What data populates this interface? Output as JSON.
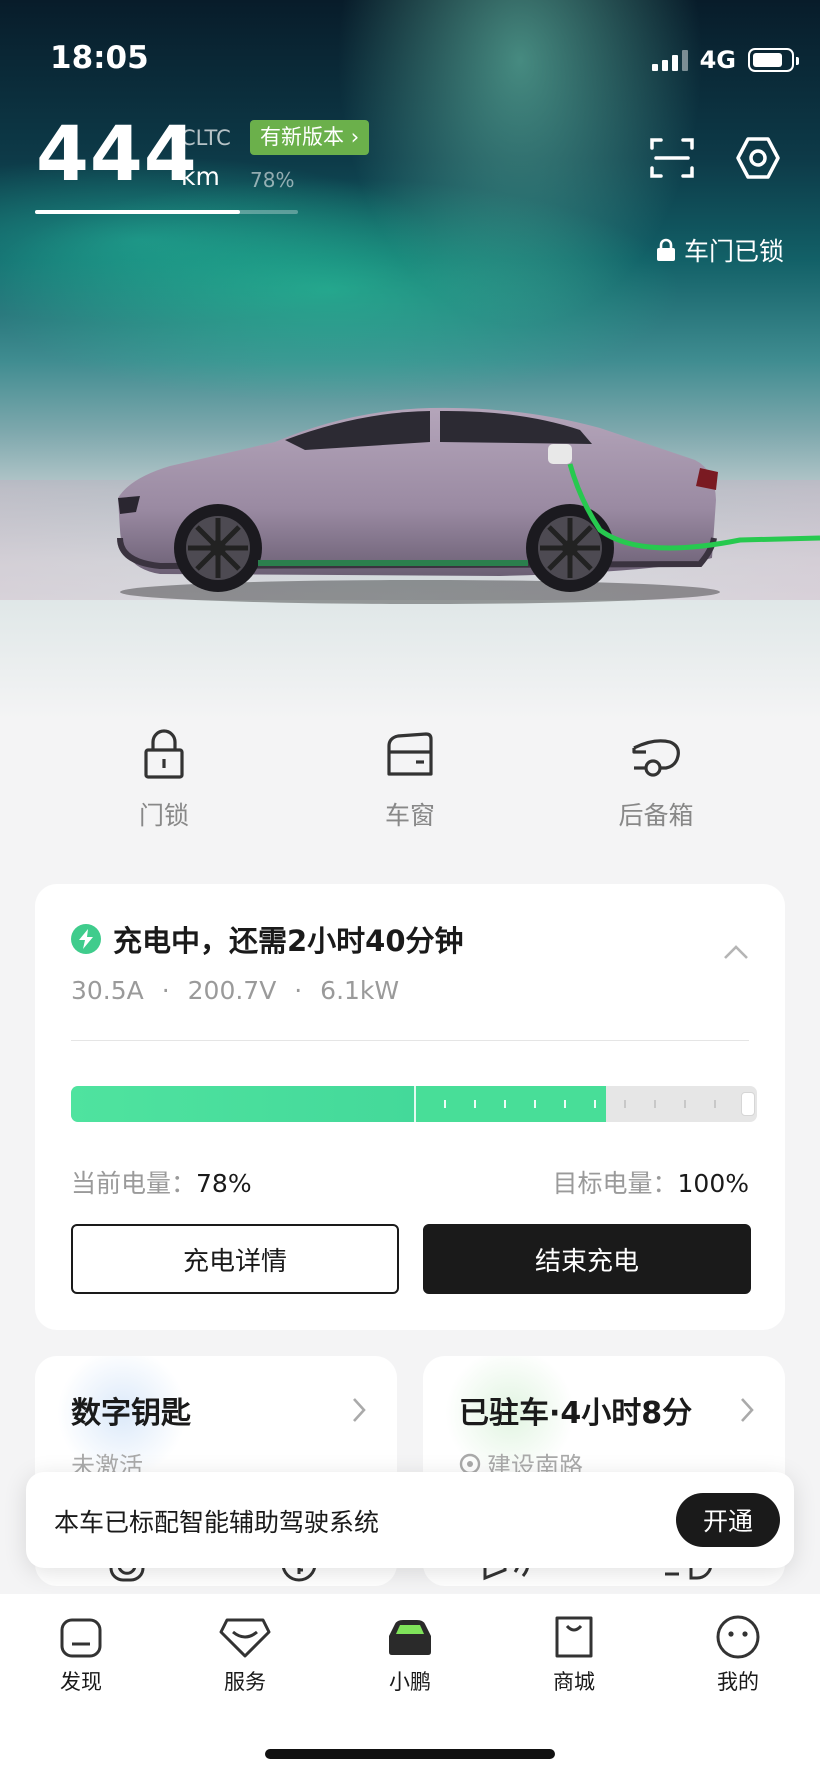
{
  "status_bar": {
    "time": "18:05",
    "network": "4G"
  },
  "vehicle": {
    "range_value": "444",
    "range_standard": "CLTC",
    "range_unit": "km",
    "battery_percent_label": "78%",
    "battery_fraction": 0.78,
    "update_badge": "有新版本",
    "door_status": "车门已锁"
  },
  "quick_actions": [
    {
      "label": "门锁",
      "icon": "padlock-icon"
    },
    {
      "label": "车窗",
      "icon": "car-window-icon"
    },
    {
      "label": "后备箱",
      "icon": "trunk-icon"
    }
  ],
  "charging": {
    "title": "充电中，还需2小时40分钟",
    "current": "30.5A",
    "voltage": "200.7V",
    "power": "6.1kW",
    "separator": "·",
    "current_label": "当前电量：",
    "current_value": "78%",
    "current_fraction": 0.78,
    "charged_start_fraction": 0.5,
    "target_label": "目标电量：",
    "target_value": "100%",
    "details_button": "充电详情",
    "stop_button": "结束充电"
  },
  "digital_key": {
    "title": "数字钥匙",
    "status": "未激活"
  },
  "parking": {
    "title": "已驻车·4小时8分",
    "location": "建设南路"
  },
  "toast": {
    "message": "本车已标配智能辅助驾驶系统",
    "action": "开通"
  },
  "tabs": [
    {
      "label": "发现",
      "icon": "discover-icon"
    },
    {
      "label": "服务",
      "icon": "service-icon"
    },
    {
      "label": "小鹏",
      "icon": "car-icon"
    },
    {
      "label": "商城",
      "icon": "shop-icon"
    },
    {
      "label": "我的",
      "icon": "profile-icon"
    }
  ],
  "colors": {
    "accent_green": "#3fcc8c",
    "badge_green": "#6bb04b",
    "dark": "#1a1a1a"
  }
}
